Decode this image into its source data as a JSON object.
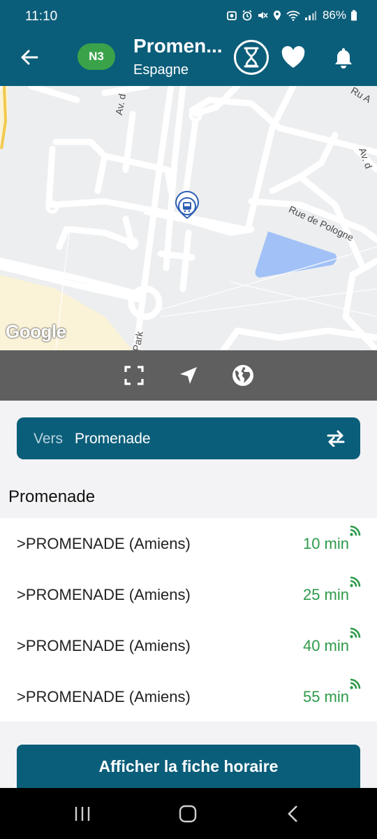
{
  "status_bar": {
    "time": "11:10",
    "battery": "86%",
    "icons": [
      "photo-icon",
      "alarm-icon",
      "mute-icon",
      "location-icon",
      "wifi-icon",
      "signal-icon",
      "battery-icon"
    ]
  },
  "header": {
    "line_badge": "N3",
    "stop_name": "Promen...",
    "stop_area": "Espagne",
    "badge_color": "#3aa34a",
    "bar_color": "#0b5e7a"
  },
  "map": {
    "street_labels": [
      "Av. d",
      "Rue de Pologne",
      "Av. d",
      "Park",
      "Ru A"
    ],
    "attribution": "Google"
  },
  "map_toolbar": {
    "icons": [
      "fullscreen-icon",
      "navigate-icon",
      "globe-icon"
    ]
  },
  "direction": {
    "prefix": "Vers",
    "destination": "Promenade"
  },
  "section_title": "Promenade",
  "departures": [
    {
      "destination": "PROMENADE (Amiens)",
      "time": "10 min"
    },
    {
      "destination": "PROMENADE (Amiens)",
      "time": "25 min"
    },
    {
      "destination": "PROMENADE (Amiens)",
      "time": "40 min"
    },
    {
      "destination": "PROMENADE (Amiens)",
      "time": "55 min"
    }
  ],
  "departure_marker": ">",
  "timetable_button": "Afficher la fiche horaire"
}
